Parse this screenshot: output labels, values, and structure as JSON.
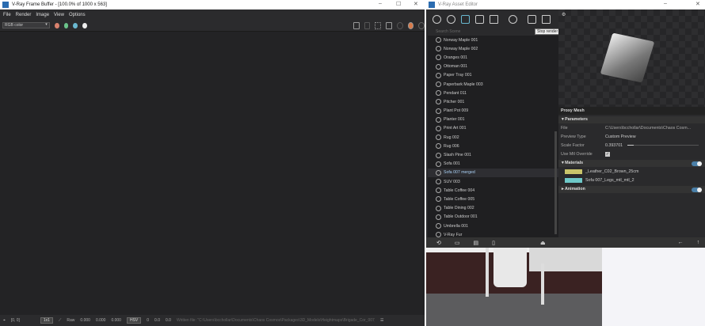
{
  "vfb": {
    "title": "V-Ray Frame Buffer - [100.0% of 1000 x 563]",
    "menu": [
      "File",
      "Render",
      "Image",
      "View",
      "Options"
    ],
    "channel": "RGB color",
    "status": {
      "coords": "[0, 0]",
      "zoom": "1x1",
      "raw_label": "Raw",
      "rgb": [
        "0.000",
        "0.000",
        "0.000"
      ],
      "color_mode": "HSV",
      "hsv": [
        "0",
        "0.0",
        "0.0"
      ],
      "message": "Written file: \"C:\\Users\\bcchollar\\Documents\\Chaos Cosmos\\Packages\\3D_Models\\Heightmaps\\Brigade_Cor_007_..."
    }
  },
  "asset_editor": {
    "title": "V-Ray Asset Editor",
    "tooltip": "Stop render",
    "search_placeholder": "Search Scene",
    "items": [
      "Norway Maple 001",
      "Norway Maple 002",
      "Oranges 001",
      "Ottoman 001",
      "Paper Tray 001",
      "Paperbark Maple 003",
      "Pendant 011",
      "Pitcher 001",
      "Plant Pot 009",
      "Planter 001",
      "Print Art 001",
      "Rug 002",
      "Rug 006",
      "Slash Pine 001",
      "Sofa 001",
      "Sofa 007 merged",
      "SUV 003",
      "Table Coffee 004",
      "Table Coffee 005",
      "Table Dining 002",
      "Table Outdoor 001",
      "Umbrella 001",
      "V-Ray Fur"
    ],
    "selected_index": 15,
    "props": {
      "header": "Proxy Mesh",
      "parameters": "Parameters",
      "file_label": "File",
      "file_value": "C:\\Users\\bcchollar\\Documents\\Chaos Cosm...",
      "preview_type_label": "Preview Type",
      "preview_type_value": "Custom Preview",
      "scale_label": "Scale Factor",
      "scale_value": "0.393701",
      "mtl_label": "Use Mtl Override",
      "mtl_checked": true,
      "materials": "Materials",
      "mat1": "_Leather_C02_Brown_25cm",
      "mat2": "Sofa 007_Legs_mtl_mtl_2",
      "animation": "Animation",
      "mat1_color": "#c9c46a",
      "mat2_color": "#6ec9c9"
    }
  }
}
